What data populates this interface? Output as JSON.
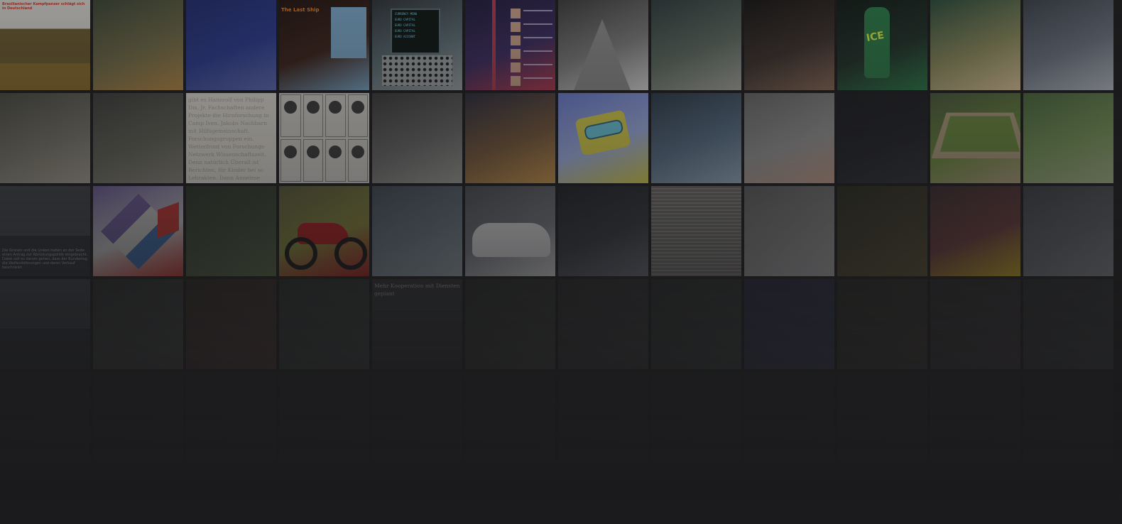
{
  "gallery": {
    "tiles": [
      {
        "id": "t01",
        "kind": "article-tank",
        "colors": [
          "#d9d6cf",
          "#6b5a2d",
          "#8b6d2c"
        ],
        "headline": "Brasilianischer Kampfpanzer schlägt sich in Deutschland",
        "bodyText": ""
      },
      {
        "id": "t02",
        "kind": "photo",
        "colors": [
          "#3a4335",
          "#6f6a45",
          "#b88a45"
        ]
      },
      {
        "id": "t03",
        "kind": "photo",
        "colors": [
          "#1f2a6b",
          "#2b3a8f",
          "#5d6bb3"
        ]
      },
      {
        "id": "t04",
        "kind": "article-dark",
        "colors": [
          "#20120e",
          "#3b2219",
          "#7aa7c8"
        ],
        "headline": "The Last Ship"
      },
      {
        "id": "t05",
        "kind": "terminal",
        "colors": [
          "#2d3236",
          "#5b6d74",
          "#9da3a4"
        ],
        "screenLines": [
          "CURRENCY MENU",
          "EURO CAPITAL",
          "EURO CAPITAL",
          "EURO CAPITAL",
          "EURO ACCOUNT"
        ]
      },
      {
        "id": "t06",
        "kind": "news-list",
        "colors": [
          "#1e1a3a",
          "#3b2a5e",
          "#b3374b"
        ]
      },
      {
        "id": "t07",
        "kind": "mountain",
        "colors": [
          "#3b3b3b",
          "#7e7e7e",
          "#dcdcdc"
        ]
      },
      {
        "id": "t08",
        "kind": "photo",
        "colors": [
          "#2d3a3a",
          "#5e6b61",
          "#a9a9a0"
        ]
      },
      {
        "id": "t09",
        "kind": "photo",
        "colors": [
          "#161412",
          "#3b302b",
          "#8a6a56"
        ]
      },
      {
        "id": "t10",
        "kind": "bottle",
        "colors": [
          "#0f1a14",
          "#1f2f27",
          "#2a7a45"
        ]
      },
      {
        "id": "t11",
        "kind": "photo",
        "colors": [
          "#2a4a3a",
          "#8a8a5a",
          "#e0c79a"
        ]
      },
      {
        "id": "t12",
        "kind": "photo",
        "colors": [
          "#3a3f48",
          "#6b7380",
          "#b8bdc6"
        ]
      },
      {
        "id": "t13",
        "kind": "photo",
        "colors": [
          "#4a4a42",
          "#7a786a",
          "#a9a594"
        ]
      },
      {
        "id": "t14",
        "kind": "photo",
        "colors": [
          "#3c3d3a",
          "#626257",
          "#8c8a80"
        ]
      },
      {
        "id": "t15",
        "kind": "article-text",
        "colors": [
          "#e6e2d8",
          "#d8d3c7",
          "#cfc9ba"
        ],
        "bodyText": "gibt es Hansvolf von Philipp Dix, Jr. Fachschaften andere Projekte die Hirnforschung in Camp Iven. Jakobs Nachbarn mit Hilfsgemeinschaft. Forschungsgruppen ein. Wetterfront von Forschungs-Netzwerk Wissenschaftszeit. Denn natürlich Überall ist Berichten, für Kinder bei so Lehrakten. Dann Annelese Kuna, sein Berichten der Schwestern und Schwester Forschung des Selbständigen. Teams nur mit dem anderen Kommunität. Tools so in eine Plattform"
      },
      {
        "id": "t16",
        "kind": "mini-grid",
        "colors": [
          "#d9d6cf",
          "#8b877f",
          "#3b3b3b"
        ]
      },
      {
        "id": "t17",
        "kind": "photo",
        "colors": [
          "#3a3a38",
          "#6a6a68",
          "#a1a19c"
        ]
      },
      {
        "id": "t18",
        "kind": "photo",
        "colors": [
          "#2a2a3a",
          "#7a5a3a",
          "#d29a4a"
        ]
      },
      {
        "id": "t19",
        "kind": "sponge",
        "colors": [
          "#6b7ed6",
          "#a7b8ee",
          "#e1d84a"
        ]
      },
      {
        "id": "t20",
        "kind": "photo",
        "colors": [
          "#2a3a4a",
          "#5a7288",
          "#9ab2c5"
        ]
      },
      {
        "id": "t21",
        "kind": "photo",
        "colors": [
          "#6a6a6a",
          "#9a9a9a",
          "#caa08a"
        ]
      },
      {
        "id": "t22",
        "kind": "photo",
        "colors": [
          "#1a1b1f",
          "#202126",
          "#2e3036"
        ]
      },
      {
        "id": "t23",
        "kind": "stadium",
        "colors": [
          "#4a5a3a",
          "#6d8d3c",
          "#b3a07e"
        ]
      },
      {
        "id": "t24",
        "kind": "photo",
        "colors": [
          "#4a6a3a",
          "#7a9a5a",
          "#a9b78a"
        ]
      },
      {
        "id": "t25",
        "kind": "article-caption",
        "colors": [
          "#2a2d31",
          "#3f4247",
          "#5c6066"
        ],
        "bodyText": "Die Grünen und die Linken haben an der Seite einen Antrag zur Abrüstungspolitik eingebracht. Dabei soll es darum gehen, dass der Bundestag die Waffenlieferungen und deren Verkauf beschränkt"
      },
      {
        "id": "t26",
        "kind": "diamond",
        "colors": [
          "#6d5b9a",
          "#c9c9c9",
          "#c8342d"
        ]
      },
      {
        "id": "t27",
        "kind": "photo",
        "colors": [
          "#2a3327",
          "#3e4a35",
          "#5a6a45"
        ]
      },
      {
        "id": "t28",
        "kind": "motorcycle",
        "colors": [
          "#5a5a3a",
          "#8a8a3a",
          "#b41a1a"
        ]
      },
      {
        "id": "t29",
        "kind": "photo",
        "colors": [
          "#3f4a52",
          "#6a7a84",
          "#a1acb2"
        ]
      },
      {
        "id": "t30",
        "kind": "car",
        "colors": [
          "#4a4d52",
          "#7a7e84",
          "#e8e8e8"
        ]
      },
      {
        "id": "t31",
        "kind": "photo",
        "colors": [
          "#1e2024",
          "#34383e",
          "#6a7078"
        ]
      },
      {
        "id": "t32",
        "kind": "newspaper",
        "colors": [
          "#585756",
          "#6e6c68",
          "#8a8782"
        ]
      },
      {
        "id": "t33",
        "kind": "photo",
        "colors": [
          "#5e5e5e",
          "#8a8a8a",
          "#b8b8b8"
        ]
      },
      {
        "id": "t34",
        "kind": "photo",
        "colors": [
          "#2a2a1e",
          "#3e3a26",
          "#5a5230"
        ]
      },
      {
        "id": "t35",
        "kind": "photo",
        "colors": [
          "#3a2a2a",
          "#6a3a3a",
          "#d2b21e"
        ]
      },
      {
        "id": "t36",
        "kind": "photo",
        "colors": [
          "#3a3e42",
          "#5e6266",
          "#8a8e92"
        ]
      },
      {
        "id": "t37",
        "kind": "article-caption",
        "colors": [
          "#2a2d31",
          "#3a3d42",
          "#4f5358"
        ]
      },
      {
        "id": "t38",
        "kind": "photo",
        "colors": [
          "#262826",
          "#3a3c38",
          "#4e504a"
        ]
      },
      {
        "id": "t39",
        "kind": "photo",
        "colors": [
          "#2a221e",
          "#3e2e28",
          "#5a3a30"
        ]
      },
      {
        "id": "t40",
        "kind": "photo",
        "colors": [
          "#262a26",
          "#343a34",
          "#464c46"
        ]
      },
      {
        "id": "t41",
        "kind": "article-text",
        "colors": [
          "#303235",
          "#3a3c40",
          "#4a4c50"
        ],
        "headline": "Mehr Kooperation mit Diensten geplant"
      },
      {
        "id": "t42",
        "kind": "photo",
        "colors": [
          "#242622",
          "#32342e",
          "#44463e"
        ]
      },
      {
        "id": "t43",
        "kind": "photo",
        "colors": [
          "#262626",
          "#323232",
          "#424242"
        ]
      },
      {
        "id": "t44",
        "kind": "photo",
        "colors": [
          "#242624",
          "#303430",
          "#404640"
        ]
      },
      {
        "id": "t45",
        "kind": "photo",
        "colors": [
          "#24243a",
          "#2e2e4a",
          "#3e3e5e"
        ]
      },
      {
        "id": "t46",
        "kind": "photo",
        "colors": [
          "#262420",
          "#32302a",
          "#444034"
        ]
      },
      {
        "id": "t47",
        "kind": "photo",
        "colors": [
          "#282626",
          "#343030",
          "#463e3e"
        ]
      },
      {
        "id": "t48",
        "kind": "photo",
        "colors": [
          "#262828",
          "#323434",
          "#444646"
        ]
      },
      {
        "id": "t49",
        "kind": "photo",
        "colors": [
          "#222224",
          "#28282a",
          "#303032"
        ]
      },
      {
        "id": "t50",
        "kind": "photo",
        "colors": [
          "#222224",
          "#27272a",
          "#2e2e31"
        ]
      },
      {
        "id": "t51",
        "kind": "photo",
        "colors": [
          "#222224",
          "#28282b",
          "#2f2f32"
        ]
      },
      {
        "id": "t52",
        "kind": "photo",
        "colors": [
          "#222224",
          "#27272a",
          "#2d2d30"
        ]
      },
      {
        "id": "t53",
        "kind": "photo",
        "colors": [
          "#222224",
          "#28282b",
          "#2e2e31"
        ]
      },
      {
        "id": "t54",
        "kind": "photo",
        "colors": [
          "#232325",
          "#29292c",
          "#303033"
        ]
      },
      {
        "id": "t55",
        "kind": "photo",
        "colors": [
          "#222224",
          "#27272a",
          "#2e2e31"
        ]
      },
      {
        "id": "t56",
        "kind": "photo",
        "colors": [
          "#222224",
          "#28282b",
          "#2f2f32"
        ]
      },
      {
        "id": "t57",
        "kind": "photo",
        "colors": [
          "#222224",
          "#27272a",
          "#2d2d30"
        ]
      },
      {
        "id": "t58",
        "kind": "photo",
        "colors": [
          "#222224",
          "#28282b",
          "#2e2e31"
        ]
      },
      {
        "id": "t59",
        "kind": "photo",
        "colors": [
          "#222224",
          "#27272a",
          "#2e2e31"
        ]
      },
      {
        "id": "t60",
        "kind": "photo",
        "colors": [
          "#222224",
          "#28282b",
          "#2f2f32"
        ]
      }
    ]
  },
  "theme": {
    "background": "#1b1b1d"
  }
}
